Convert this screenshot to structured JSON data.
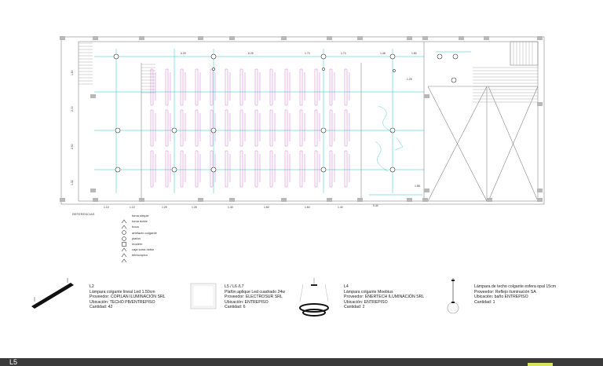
{
  "plan": {
    "dims_top": [
      "6.25",
      "6.25",
      "1.74",
      "1.74",
      "1.48",
      "1.80"
    ],
    "dims_bottom": [
      "1.10",
      "1.10",
      "1.25",
      "1.25",
      "1.40",
      "1.60",
      "1.60",
      "1.40"
    ],
    "dims_left": [
      "1.60",
      "2.00",
      "2.50",
      "1.32"
    ],
    "dim_small": [
      "1.25",
      "1.58",
      "0.44"
    ],
    "accent_cyan": "#27c3c8",
    "accent_magenta": "#c23bc2",
    "line_gray": "#888888"
  },
  "legend": {
    "title": "REFERENCIAS",
    "items": [
      {
        "icon": "single-outlet-icon",
        "label": "toma simple"
      },
      {
        "icon": "double-outlet-icon",
        "label": "toma doble"
      },
      {
        "icon": "mouth-icon",
        "label": "boca"
      },
      {
        "icon": "pendant-icon",
        "label": "artefacto colgante"
      },
      {
        "icon": "ceiling-icon",
        "label": "plafón"
      },
      {
        "icon": "modem-icon",
        "label": "modem"
      },
      {
        "icon": "telescopic-box-icon",
        "label": "caja toma doble"
      },
      {
        "icon": "telescopic-box-icon",
        "label": "telescópico"
      }
    ]
  },
  "products": [
    {
      "code": "L2",
      "desc": "Lámpara colgante lineal Led 1.50cm",
      "supplier": "Proveedor: COPILAN ILUMINACIÓN SRL",
      "location": "Ubicación: TECHO PB/ENTREPISO",
      "qty": "Cantidad: 42",
      "icon": "linear-lamp-icon"
    },
    {
      "code": "L5 / L6 /L7",
      "desc": "Plafón aplique Led cuadrado 24w",
      "supplier": "Proveedor: ELECTROSUR SRL",
      "location": "Ubicación: ENTREPISO",
      "qty": "Cantidad: 6",
      "icon": "square-panel-icon"
    },
    {
      "code": "L4",
      "desc": "Lámpara colgante Moebius",
      "supplier": "Proveedor: ENERTECH ILUMINACIÓN SRL",
      "location": "Ubicación: ENTREPISO",
      "qty": "Cantidad: 2",
      "icon": "moebius-lamp-icon"
    },
    {
      "code": "",
      "desc": "Lámpara de techo colgante esfera opal 15cm",
      "supplier": "Proveedor: Reflejo iluminación SA",
      "location": "Ubicación: baño ENTREPISO",
      "qty": "Cantidad: 1",
      "icon": "sphere-lamp-icon"
    }
  ],
  "footer": {
    "title": "L5"
  }
}
